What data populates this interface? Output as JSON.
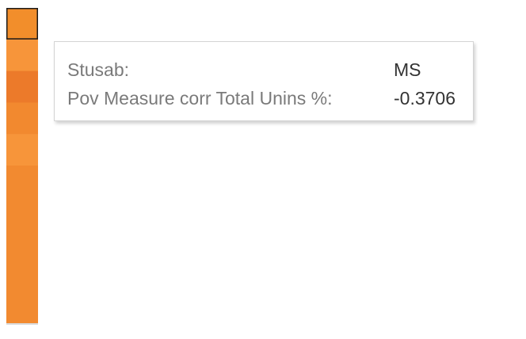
{
  "chart_data": {
    "type": "heatmap",
    "cells": [
      {
        "color": "#f28e2b",
        "selected": true
      },
      {
        "color": "#f7953a"
      },
      {
        "color": "#ec7a2a"
      },
      {
        "color": "#f2892f"
      },
      {
        "color": "#f7953a"
      },
      {
        "color": "#f28a30"
      },
      {
        "color": "#f28a30"
      },
      {
        "color": "#f28a30"
      },
      {
        "color": "#f28a30"
      },
      {
        "color": "#f28a30"
      }
    ],
    "baseline_color": "#d9d9d9"
  },
  "tooltip": {
    "rows": [
      {
        "label": "Stusab:",
        "value": "MS"
      },
      {
        "label": "Pov Measure corr Total Unins %:",
        "value": "-0.3706"
      }
    ]
  }
}
